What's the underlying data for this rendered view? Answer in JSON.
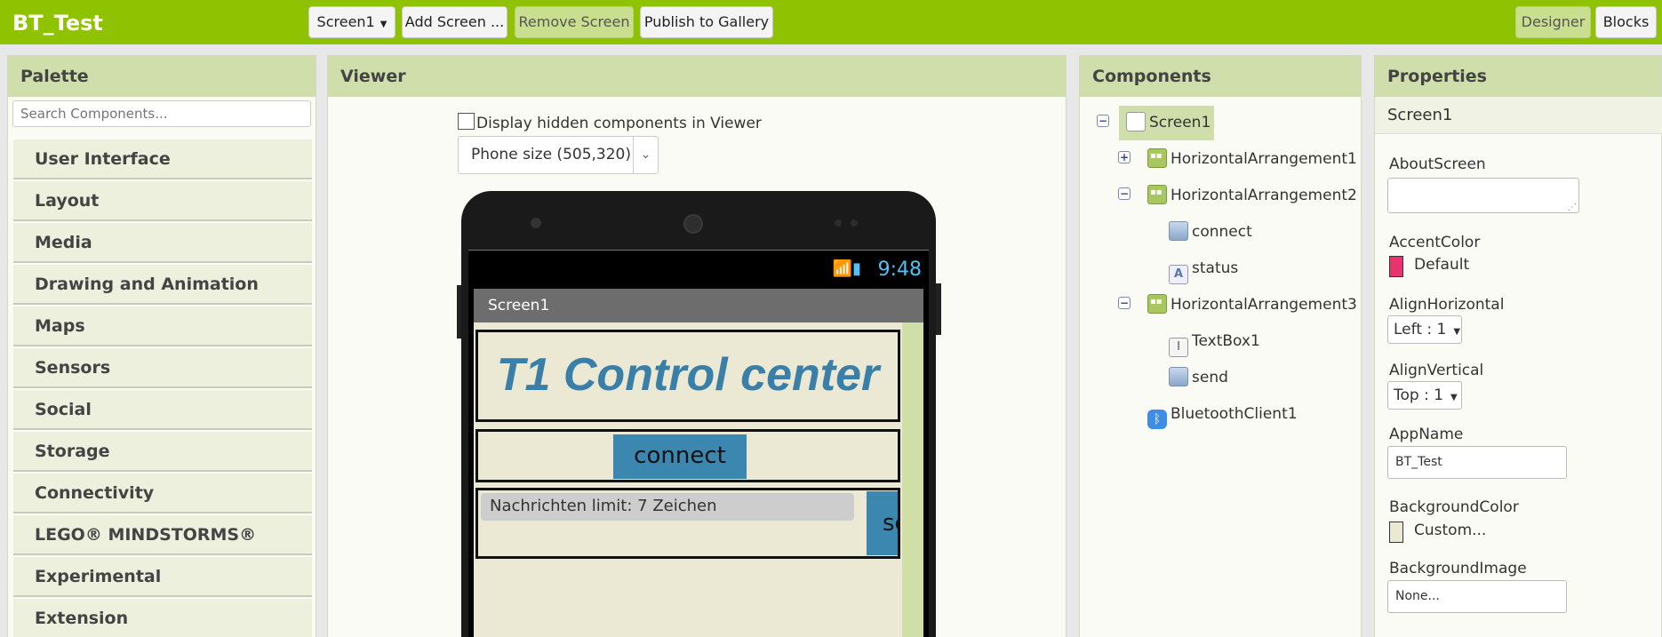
{
  "app": {
    "title": "BT_Test"
  },
  "toolbar": {
    "screen_select": "Screen1",
    "add_screen": "Add Screen ...",
    "remove_screen": "Remove Screen",
    "publish": "Publish to Gallery",
    "designer": "Designer",
    "blocks": "Blocks"
  },
  "palette": {
    "title": "Palette",
    "search_placeholder": "Search Components...",
    "categories": [
      "User Interface",
      "Layout",
      "Media",
      "Drawing and Animation",
      "Maps",
      "Sensors",
      "Social",
      "Storage",
      "Connectivity",
      "LEGO® MINDSTORMS®",
      "Experimental",
      "Extension"
    ]
  },
  "viewer": {
    "title": "Viewer",
    "hidden_label": "Display hidden components in Viewer",
    "hidden_checked": false,
    "phone_size": "Phone size (505,320)",
    "phone": {
      "time": "9:48",
      "screen_title": "Screen1",
      "big_title": "T1 Control center",
      "connect_label": "connect",
      "textbox_hint": "Nachrichten limit: 7 Zeichen",
      "send_label": "se"
    }
  },
  "components": {
    "title": "Components",
    "items": [
      "Screen1",
      "HorizontalArrangement1",
      "HorizontalArrangement2",
      "connect",
      "status",
      "HorizontalArrangement3",
      "TextBox1",
      "send",
      "BluetoothClient1"
    ]
  },
  "properties": {
    "title": "Properties",
    "selected": "Screen1",
    "about_label": "AboutScreen",
    "accent_label": "AccentColor",
    "accent_value": "Default",
    "accent_color": "#e8336e",
    "align_h_label": "AlignHorizontal",
    "align_h_value": "Left : 1",
    "align_v_label": "AlignVertical",
    "align_v_value": "Top : 1",
    "appname_label": "AppName",
    "appname_value": "BT_Test",
    "bg_color_label": "BackgroundColor",
    "bg_color_value": "Custom...",
    "bg_color": "#ebe8d4",
    "bg_image_label": "BackgroundImage",
    "bg_image_value": "None..."
  },
  "colors": {
    "brand": "#8fc200",
    "panel_header": "#cfdeaa",
    "accent_blue": "#3b87b0"
  }
}
